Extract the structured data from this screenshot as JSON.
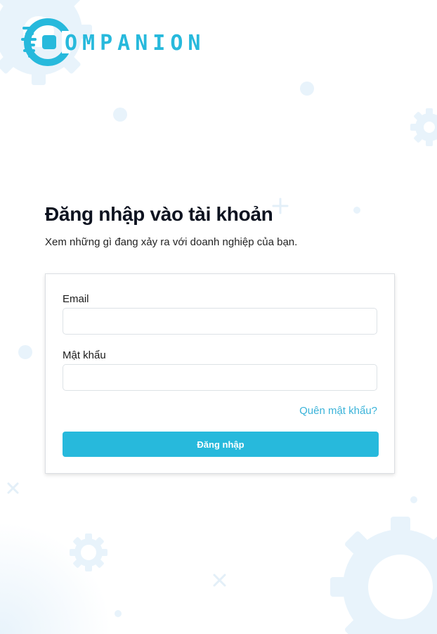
{
  "brand": {
    "logo_text": "OMPANION",
    "color": "#27b9dc"
  },
  "login": {
    "title": "Đăng nhập vào tài khoản",
    "subtitle": "Xem những gì đang xảy ra với doanh nghiệp của bạn.",
    "email_label": "Email",
    "email_value": "",
    "password_label": "Mật khẩu",
    "password_value": "",
    "forgot_link": "Quên mật khẩu?",
    "submit_label": "Đăng nhập"
  },
  "colors": {
    "accent": "#27b9dc",
    "link": "#3ab3d9",
    "decoration": "#e8f3fb"
  },
  "icons": [
    "gear-decoration-icon",
    "plus-decoration-icon",
    "cross-decoration-icon",
    "company-logo-icon"
  ]
}
